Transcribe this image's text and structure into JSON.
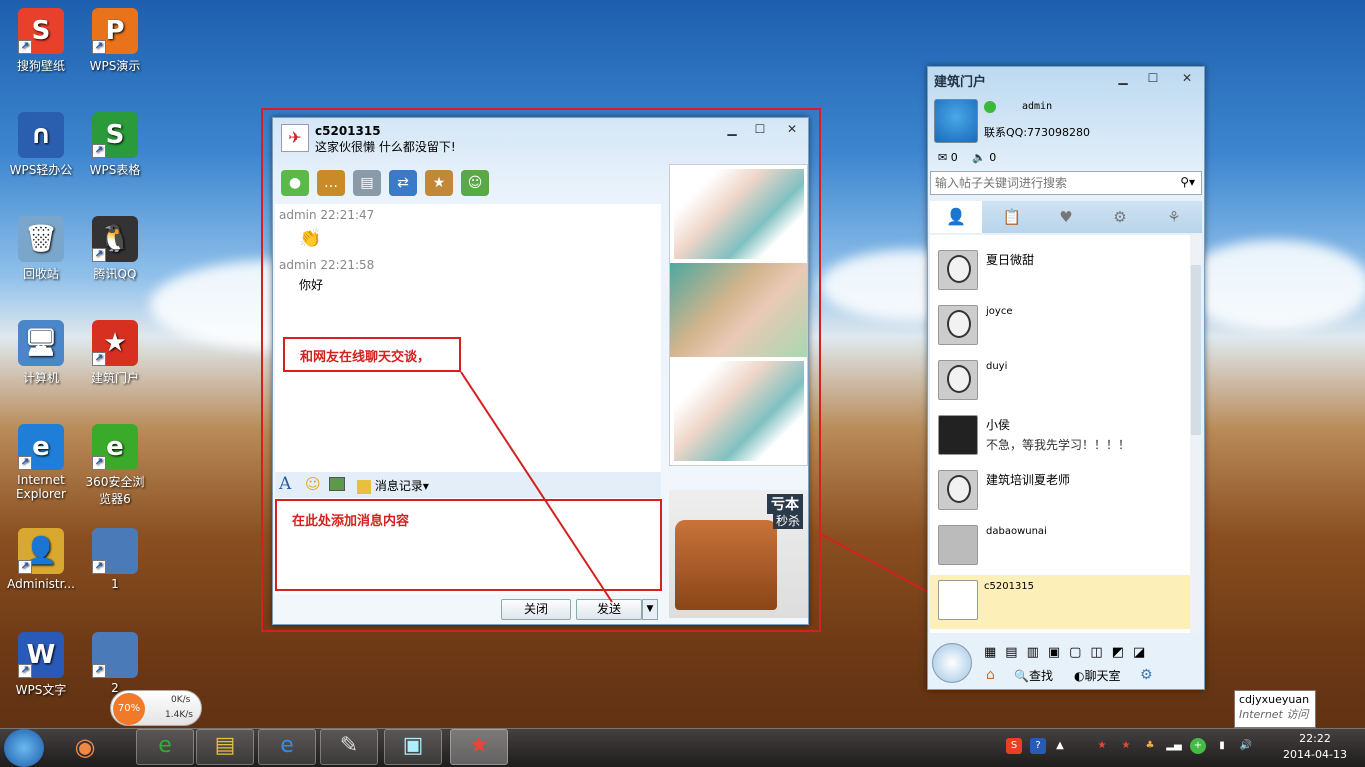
{
  "desktop": {
    "icons": [
      {
        "label": "搜狗壁纸",
        "glyph": "S",
        "color": "#e8402a"
      },
      {
        "label": "WPS演示",
        "glyph": "P",
        "color": "#e8731a"
      },
      {
        "label": "WPS轻办公",
        "glyph": "∩",
        "color": "#2a5fb0"
      },
      {
        "label": "WPS表格",
        "glyph": "S",
        "color": "#2a9a3a"
      },
      {
        "label": "回收站",
        "glyph": "🗑",
        "color": "#7aa6cc"
      },
      {
        "label": "腾讯QQ",
        "glyph": "🐧",
        "color": "#333333"
      },
      {
        "label": "计算机",
        "glyph": "🖥",
        "color": "#4a86c8"
      },
      {
        "label": "建筑门户",
        "glyph": "★",
        "color": "#d83020"
      },
      {
        "label": "Internet Explorer",
        "glyph": "e",
        "color": "#1f7fd8"
      },
      {
        "label": "360安全浏览器6",
        "glyph": "e",
        "color": "#3aaa2a"
      },
      {
        "label": "Administr...",
        "glyph": "👤",
        "color": "#d8a830"
      },
      {
        "label": "1",
        "glyph": "",
        "color": "#4a7ab8"
      },
      {
        "label": "WPS文字",
        "glyph": "W",
        "color": "#2a5ab8"
      },
      {
        "label": "2",
        "glyph": "",
        "color": "#4a7ab8"
      }
    ]
  },
  "netspeed": {
    "percent": "70%",
    "up": "0K/s",
    "down": "1.4K/s"
  },
  "chat": {
    "contact": "c5201315",
    "signature": "这家伙很懒 什么都没留下!",
    "messages": [
      {
        "meta": "admin 22:21:47",
        "text": ""
      },
      {
        "meta": "admin 22:21:58",
        "text": "你好"
      }
    ],
    "history_label": "消息记录",
    "close_label": "关闭",
    "send_label": "发送",
    "ad_text1": "亏本",
    "ad_text2": "秒杀"
  },
  "annotations": {
    "chat_note": "和网友在线聊天交谈，",
    "input_note": "在此处添加消息内容"
  },
  "qq": {
    "title": "建筑门户",
    "user": "admin",
    "contact_qq": "联系QQ:773098280",
    "mail_count": "0",
    "sound_count": "0",
    "search_placeholder": "输入帖子关键词进行搜索",
    "contacts": [
      {
        "name": "夏日微甜",
        "msg": ""
      },
      {
        "name": "joyce",
        "msg": ""
      },
      {
        "name": "duyi",
        "msg": ""
      },
      {
        "name": "小侯",
        "msg": "不急，等我先学习！！！！"
      },
      {
        "name": "建筑培训夏老师",
        "msg": ""
      },
      {
        "name": "dabaowunai",
        "msg": ""
      },
      {
        "name": "c5201315",
        "msg": ""
      }
    ],
    "find_label": "查找",
    "chatroom_label": "聊天室"
  },
  "tooltip": {
    "line1": "cdjyxueyuan",
    "line2": "Internet 访问"
  },
  "taskbar": {
    "time": "22:22",
    "date": "2014-04-13"
  }
}
